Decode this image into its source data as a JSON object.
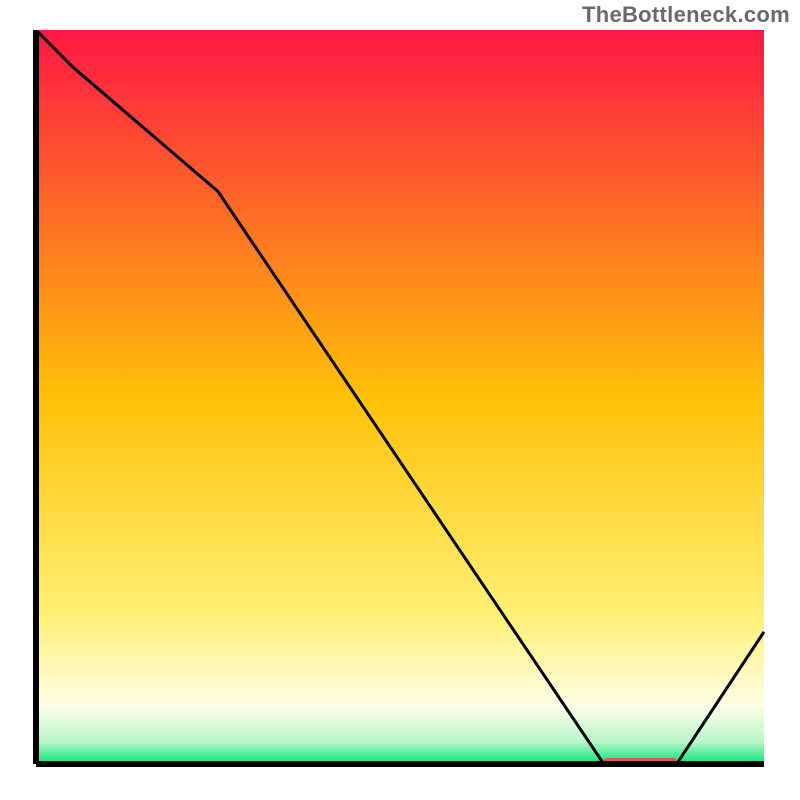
{
  "source_label": "TheBottleneck.com",
  "chart_data": {
    "type": "line",
    "title": "",
    "xlabel": "",
    "ylabel": "",
    "xlim": [
      0,
      100
    ],
    "ylim": [
      0,
      100
    ],
    "x": [
      0,
      5,
      25,
      78,
      88,
      100
    ],
    "y": [
      100,
      95,
      78,
      0,
      0,
      18
    ],
    "optimum_band": {
      "x_start": 78,
      "x_end": 88,
      "y": 0
    },
    "gradient_stops": [
      {
        "pos": 0.0,
        "color": "#ff1744"
      },
      {
        "pos": 0.5,
        "color": "#ffc107"
      },
      {
        "pos": 0.8,
        "color": "#fff176"
      },
      {
        "pos": 0.92,
        "color": "#fffde7"
      },
      {
        "pos": 0.97,
        "color": "#b9f6ca"
      },
      {
        "pos": 1.0,
        "color": "#00e676"
      }
    ],
    "axis_color": "#000000",
    "line_color": "#000000",
    "band_color": "#d35b5b"
  }
}
